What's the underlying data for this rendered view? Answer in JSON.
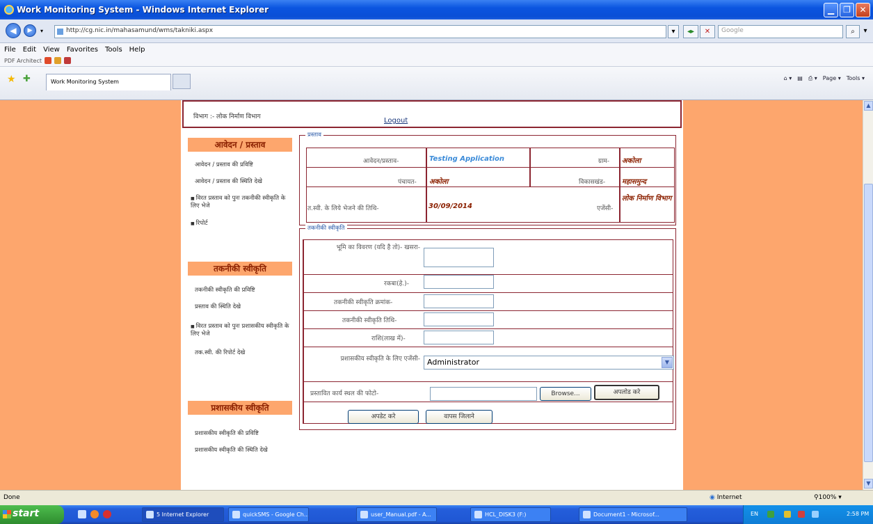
{
  "window": {
    "title": "Work Monitoring System - Windows Internet Explorer",
    "min": "▁",
    "max": "❐",
    "close": "✕"
  },
  "address": {
    "url": "http://cg.nic.in/mahasamund/wms/takniki.aspx",
    "search_placeholder": "Google",
    "go": "◂▸",
    "stop": "✕",
    "search_btn": "⌕"
  },
  "menu": {
    "items": [
      "File",
      "Edit",
      "View",
      "Favorites",
      "Tools",
      "Help"
    ],
    "pdf_label": "PDF Architect"
  },
  "tabbar": {
    "tab_title": "Work Monitoring System",
    "commands": [
      "Page ▾",
      "Tools ▾"
    ]
  },
  "header": {
    "department": "विभाग :- लोक निर्माण विभाग",
    "logout": "Logout"
  },
  "sidebar": {
    "section1": {
      "heading": "आवेदन / प्रस्ताव",
      "links": [
        "आवेदन / प्रस्ताव की प्रविष्टि",
        "आवेदन / प्रस्ताव की स्थिति देखे",
        "विरत प्रस्ताव को पुनः तकनीकी स्वीकृति के लिए भेजे",
        "रिपोर्ट"
      ]
    },
    "section2": {
      "heading": "तकनीकी स्वीकृति",
      "links": [
        "तकनीकी स्वीकृति की प्रविष्टि",
        "प्रस्ताव की स्थिति देखे",
        "विरत प्रस्ताव को पुनः प्रशासकीय स्वीकृति के लिए भेजे",
        "तक.स्वी. की रिपोर्ट देखे"
      ]
    },
    "section3": {
      "heading": "प्रशासकीय स्वीकृति",
      "links": [
        "प्रशासकीय स्वीकृति की प्रविष्टि",
        "प्रशासकीय स्वीकृति की स्थिति देखे"
      ]
    }
  },
  "proposal": {
    "legend": "प्रस्ताव",
    "app_label": "आवेदन/प्रस्ताव-",
    "app_value": "Testing Application",
    "district_label": "ग्राम-",
    "district_value": "अकोला",
    "panchayat_label": "पंचायत-",
    "panchayat_value": "अकोला",
    "block_label": "विकासखंड-",
    "block_value": "महासमुन्द",
    "date_label": "त.स्वी. के लिये भेजने की तिथि-",
    "date_value": "30/09/2014",
    "agency_label": "एजेंसी-",
    "agency_value": "लोक निर्माण विभाग"
  },
  "technical": {
    "legend": "तकनीकी स्वीकृति",
    "land_label": "भूमि का विवरण (यदि है तो)- खसरा-",
    "area_label": "रकबा(हे.)-",
    "ts_number_label": "तकनीकी स्वीकृति क्रमांक-",
    "ts_date_label": "तकनीकी स्वीकृति तिथि-",
    "amount_label": "राशि(लाख में)-",
    "admin_agency_label": "प्रशासकीय स्वीकृति के लिए एजेंसी-",
    "admin_agency_value": "Administrator",
    "photo_label": "प्रस्तावित कार्य स्थल की फोटो-",
    "browse": "Browse...",
    "upload": "अपलोड करे",
    "submit": "अपडेट करे",
    "back": "वापस जिलाने"
  },
  "status": {
    "text": "Done",
    "zone": "Internet",
    "zoom": "100%"
  },
  "taskbar": {
    "start": "start",
    "tasks": [
      "5 Internet Explorer",
      "quickSMS - Google Ch...",
      "user_Manual.pdf - A...",
      "HCL_DISK3 (F:)",
      "Document1 - Microsof..."
    ],
    "tray_lang": "EN",
    "clock": "2:58 PM"
  },
  "colors": {
    "page_bg": "#fda66d",
    "border": "#8b2430",
    "heading_text": "#8b2000",
    "title_bar": "#0b55e0"
  }
}
